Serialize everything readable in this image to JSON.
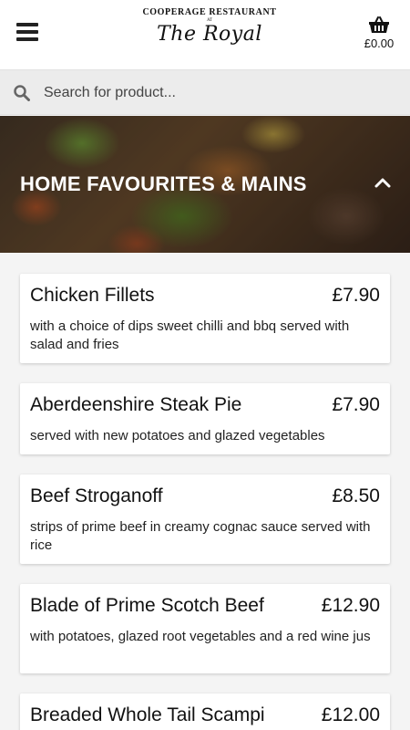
{
  "header": {
    "logo_top": "COOPERAGE RESTAURANT",
    "logo_at": "AT",
    "logo_main": "The Royal",
    "cart_total": "£0.00"
  },
  "search": {
    "placeholder": "Search for product..."
  },
  "category": {
    "title": "HOME FAVOURITES & MAINS"
  },
  "items": [
    {
      "name": "Chicken Fillets",
      "price": "£7.90",
      "description": "with a choice of dips sweet chilli and bbq served with salad and fries"
    },
    {
      "name": "Aberdeenshire Steak Pie",
      "price": "£7.90",
      "description": "served with new potatoes and glazed vegetables"
    },
    {
      "name": "Beef Stroganoff",
      "price": "£8.50",
      "description": "strips of prime beef in creamy cognac sauce served with rice"
    },
    {
      "name": "Blade of Prime Scotch Beef",
      "price": "£12.90",
      "description": "with potatoes, glazed root vegetables and a red wine jus"
    },
    {
      "name": "Breaded Whole Tail Scampi",
      "price": "£12.00",
      "description": ""
    }
  ]
}
